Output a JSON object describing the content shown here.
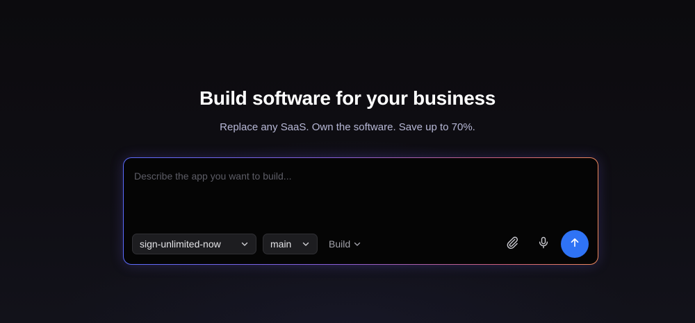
{
  "hero": {
    "title": "Build software for your business",
    "subtitle": "Replace any SaaS. Own the software. Save up to 70%."
  },
  "prompt": {
    "placeholder": "Describe the app you want to build...",
    "value": ""
  },
  "toolbar": {
    "repo_label": "sign-unlimited-now",
    "branch_label": "main",
    "mode_label": "Build",
    "icons": {
      "repo_dropdown": "chevron-down-icon",
      "branch_dropdown": "chevron-down-icon",
      "mode_dropdown": "chevron-down-icon",
      "attach": "paperclip-icon",
      "voice": "microphone-icon",
      "send": "arrow-up-icon"
    }
  },
  "colors": {
    "background": "#0b0a0d",
    "accent": "#2f73f5",
    "border_gradient_start": "#5b6cff",
    "border_gradient_end": "#f08a5c",
    "subtitle": "#b7b8d6"
  }
}
